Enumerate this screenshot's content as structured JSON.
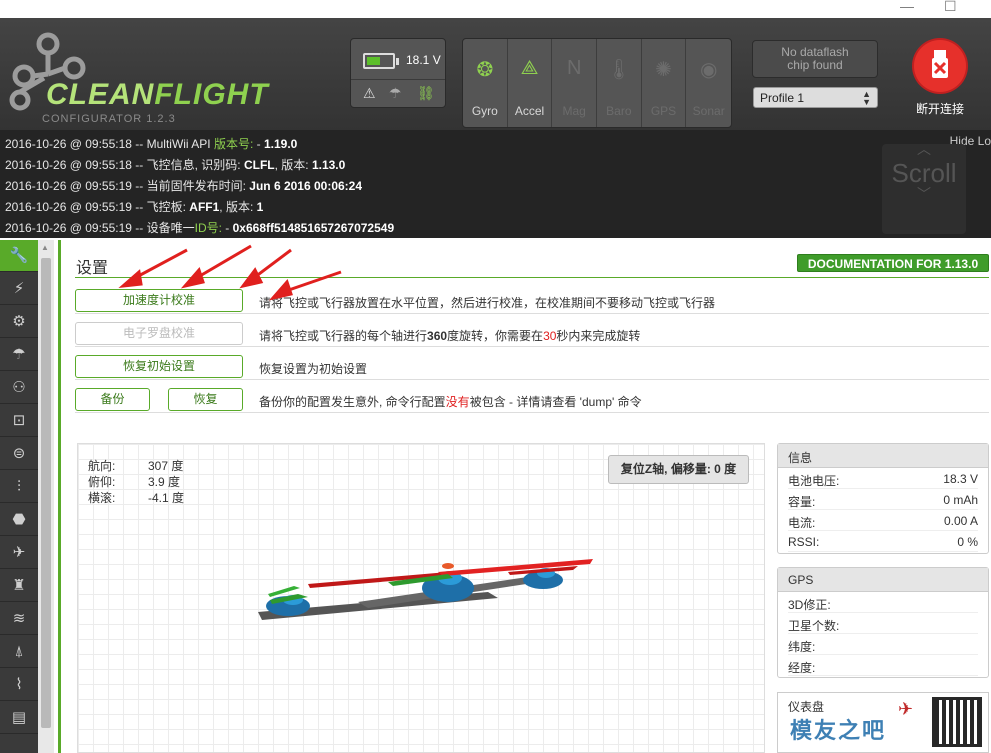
{
  "window": {
    "minimize": "—",
    "maximize": "☐"
  },
  "logo": {
    "word_a": "CLEAN",
    "word_b": "FLIGHT",
    "subtitle": "CONFIGURATOR  1.2.3"
  },
  "battery": {
    "voltage": "18.1 V",
    "fill_percent": 45
  },
  "sensors": [
    {
      "label": "Gyro",
      "icon": "gyro-icon",
      "glyph": "❂",
      "active": true
    },
    {
      "label": "Accel",
      "icon": "accel-icon",
      "glyph": "⟁",
      "active": true
    },
    {
      "label": "Mag",
      "icon": "mag-icon",
      "glyph": "N",
      "active": false
    },
    {
      "label": "Baro",
      "icon": "baro-icon",
      "glyph": "🌡",
      "active": false
    },
    {
      "label": "GPS",
      "icon": "gps-icon",
      "glyph": "✺",
      "active": false
    },
    {
      "label": "Sonar",
      "icon": "sonar-icon",
      "glyph": "◉",
      "active": false
    }
  ],
  "dataflash": {
    "line1": "No dataflash",
    "line2": "chip found"
  },
  "profile": {
    "selected": "Profile 1"
  },
  "disconnect": {
    "label": "断开连接"
  },
  "log": {
    "hide_label": "Hide Lo",
    "scroll_label": "Scroll",
    "lines": [
      {
        "prefix": "2016-10-26 @ 09:55:18 -- MultiWii API ",
        "accent": "版本号:",
        "mid": "  - ",
        "value": "1.19.0"
      },
      {
        "prefix": "2016-10-26 @ 09:55:18 -- 飞控信息, 识别码:  ",
        "accent": "",
        "mid": "",
        "value": "CLFL",
        "suffix": ", 版本:  ",
        "value2": "1.13.0"
      },
      {
        "prefix": "2016-10-26 @ 09:55:19 -- 当前固件发布时间:  ",
        "accent": "",
        "mid": "",
        "value": "Jun 6 2016 00:06:24"
      },
      {
        "prefix": "2016-10-26 @ 09:55:19 -- 飞控板:  ",
        "accent": "",
        "mid": "",
        "value": "AFF1",
        "suffix": ", 版本:  ",
        "value2": "1"
      },
      {
        "prefix": "2016-10-26 @ 09:55:19 -- 设备唯一",
        "accent": "ID号:",
        "mid": "  - ",
        "value": "0x668ff514851657267072549"
      }
    ]
  },
  "nav": [
    {
      "name": "nav-setup",
      "icon": "wrench-icon",
      "glyph": "🔧",
      "active": true
    },
    {
      "name": "nav-ports",
      "icon": "plug-icon",
      "glyph": "⚡",
      "active": false
    },
    {
      "name": "nav-configuration",
      "icon": "gear-icon",
      "glyph": "⚙",
      "active": false
    },
    {
      "name": "nav-failsafe",
      "icon": "parachute-icon",
      "glyph": "☂",
      "active": false
    },
    {
      "name": "nav-pid",
      "icon": "pid-icon",
      "glyph": "⚇",
      "active": false
    },
    {
      "name": "nav-receiver",
      "icon": "receiver-icon",
      "glyph": "⊡",
      "active": false
    },
    {
      "name": "nav-modes",
      "icon": "modes-icon",
      "glyph": "⊜",
      "active": false
    },
    {
      "name": "nav-adjustments",
      "icon": "adjustments-icon",
      "glyph": "⫶",
      "active": false
    },
    {
      "name": "nav-servos",
      "icon": "servo-icon",
      "glyph": "⬣",
      "active": false
    },
    {
      "name": "nav-gps",
      "icon": "satellite-icon",
      "glyph": "✈",
      "active": false
    },
    {
      "name": "nav-motors",
      "icon": "motor-icon",
      "glyph": "♜",
      "active": false
    },
    {
      "name": "nav-led",
      "icon": "led-icon",
      "glyph": "≋",
      "active": false
    },
    {
      "name": "nav-sensors",
      "icon": "sensor-icon",
      "glyph": "⍋",
      "active": false
    },
    {
      "name": "nav-tuning",
      "icon": "signal-icon",
      "glyph": "⌇",
      "active": false
    },
    {
      "name": "nav-logging",
      "icon": "log-icon",
      "glyph": "▤",
      "active": false
    }
  ],
  "setup": {
    "title": "设置",
    "doc_button": "DOCUMENTATION FOR 1.13.0",
    "calibrate_accel": {
      "button": "加速度计校准",
      "desc": "请将飞控或飞行器放置在水平位置，然后进行校准，在校准期间不要移动飞控或飞行器"
    },
    "calibrate_mag": {
      "button": "电子罗盘校准",
      "desc_a": "请将飞控或飞行器的每个轴进行",
      "desc_b": "360",
      "desc_c": "度旋转，你需要在",
      "desc_d": "30",
      "desc_e": "秒内来完成旋转"
    },
    "reset": {
      "button": "恢复初始设置",
      "desc": "恢复设置为初始设置"
    },
    "backup": {
      "backup_button": "备份",
      "restore_button": "恢复",
      "desc_a": "备份你的配置发生意外, 命令行配置",
      "desc_b": "没有",
      "desc_c": "被包含 - 详情请查看 'dump' 命令"
    }
  },
  "attitude": {
    "heading_label": "航向:",
    "heading_value": "307 度",
    "pitch_label": "俯仰:",
    "pitch_value": "3.9 度",
    "roll_label": "横滚:",
    "roll_value": "-4.1 度"
  },
  "reset_z": "复位Z轴, 偏移量: 0 度",
  "info": {
    "title": "信息",
    "rows": [
      {
        "label": "电池电压:",
        "value": "18.3 V"
      },
      {
        "label": "容量:",
        "value": "0 mAh"
      },
      {
        "label": "电流:",
        "value": "0.00 A"
      },
      {
        "label": "RSSI:",
        "value": "0 %"
      }
    ]
  },
  "gps": {
    "title": "GPS",
    "rows": [
      {
        "label": "3D修正:",
        "value": ""
      },
      {
        "label": "卫星个数:",
        "value": ""
      },
      {
        "label": "纬度:",
        "value": ""
      },
      {
        "label": "经度:",
        "value": ""
      }
    ]
  },
  "dashboard": {
    "title": "仪表盘",
    "watermark": "模友之吧"
  },
  "colors": {
    "accent": "#59aa29",
    "header": "#3c3c3c",
    "log_bg": "#242424",
    "disconnect": "#e6302b",
    "highlight": "#e02020"
  }
}
